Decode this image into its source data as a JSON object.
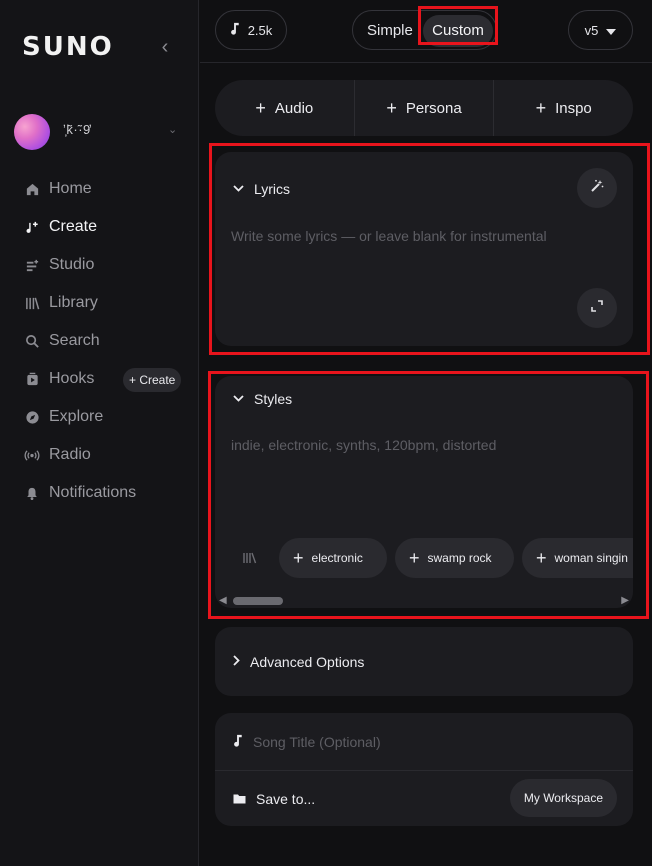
{
  "sidebar": {
    "logo": "SUNO",
    "username": "ʼ̦k̃·̃·9̓",
    "nav": [
      {
        "label": "Home",
        "icon": "home-icon"
      },
      {
        "label": "Create",
        "icon": "create-icon",
        "active": true
      },
      {
        "label": "Studio",
        "icon": "studio-icon"
      },
      {
        "label": "Library",
        "icon": "library-icon"
      },
      {
        "label": "Search",
        "icon": "search-icon"
      },
      {
        "label": "Hooks",
        "icon": "hooks-icon",
        "pill": "+ Create"
      },
      {
        "label": "Explore",
        "icon": "explore-icon"
      },
      {
        "label": "Radio",
        "icon": "radio-icon"
      },
      {
        "label": "Notifications",
        "icon": "bell-icon"
      }
    ]
  },
  "topbar": {
    "credits": "2.5k",
    "mode_simple": "Simple",
    "mode_custom": "Custom",
    "version": "v5"
  },
  "add_row": {
    "audio": "Audio",
    "persona": "Persona",
    "inspo": "Inspo"
  },
  "lyrics": {
    "title": "Lyrics",
    "placeholder": "Write some lyrics — or leave blank for instrumental"
  },
  "styles": {
    "title": "Styles",
    "placeholder": "indie, electronic, synths, 120bpm, distorted",
    "chips": [
      "electronic",
      "swamp rock",
      "woman singin"
    ]
  },
  "advanced": {
    "title": "Advanced Options"
  },
  "song": {
    "title_placeholder": "Song Title (Optional)",
    "save_to": "Save to...",
    "workspace": "My Workspace"
  },
  "colors": {
    "highlight": "#e8141c",
    "card_bg": "#1c1c20",
    "page_bg": "#101012"
  }
}
